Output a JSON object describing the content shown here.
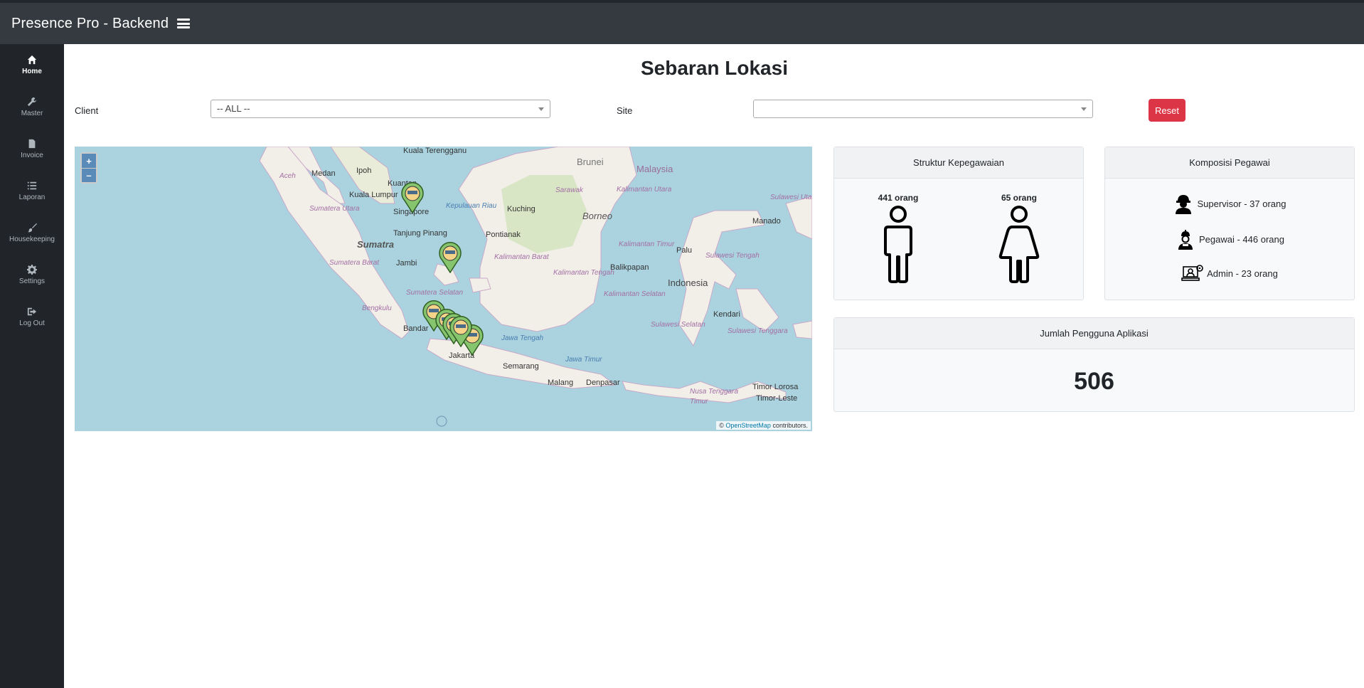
{
  "app": {
    "title": "Presence Pro - Backend"
  },
  "sidebar": {
    "items": [
      {
        "label": "Home",
        "icon": "home-icon"
      },
      {
        "label": "Master",
        "icon": "wrench-icon"
      },
      {
        "label": "Invoice",
        "icon": "file-icon"
      },
      {
        "label": "Laporan",
        "icon": "list-icon"
      },
      {
        "label": "Housekeeping",
        "icon": "brush-icon"
      },
      {
        "label": "Settings",
        "icon": "gear-icon"
      },
      {
        "label": "Log Out",
        "icon": "logout-icon"
      }
    ]
  },
  "page": {
    "title": "Sebaran Lokasi"
  },
  "filters": {
    "client_label": "Client",
    "client_value": "-- ALL --",
    "site_label": "Site",
    "site_value": "",
    "reset_label": "Reset"
  },
  "map": {
    "zoom_in": "+",
    "zoom_out": "–",
    "attribution_prefix": "©",
    "attribution_link": "OpenStreetMap",
    "attribution_suffix": "contributors.",
    "places": {
      "kuala_terengganu": "Kuala Terengganu",
      "brunei": "Brunei",
      "malaysia": "Malaysia",
      "medan": "Medan",
      "aceh": "Aceh",
      "ipoh": "Ipoh",
      "kuantan": "Kuantan",
      "kuala_lumpur": "Kuala Lumpur",
      "singapore": "Singapore",
      "sarawak": "Sarawak",
      "kalimantan_utara": "Kalimantan Utara",
      "sulawesi_utara": "Sulawesi Utara",
      "manado": "Manado",
      "sumatera_utara": "Sumatera Utara",
      "kepulauan_riau": "Kepulauan Riau",
      "kuching": "Kuching",
      "borneo": "Borneo",
      "tanjung_pinang": "Tanjung Pinang",
      "pontianak": "Pontianak",
      "sumatra": "Sumatra",
      "kalimantan_timur": "Kalimantan Timur",
      "jambi": "Jambi",
      "kalimantan_barat": "Kalimantan Barat",
      "palu": "Palu",
      "sulawesi_tengah": "Sulawesi Tengah",
      "sumatera_barat": "Sumatera Barat",
      "balikpapan": "Balikpapan",
      "indonesia": "Indonesia",
      "kalimantan_tengah": "Kalimantan Tengah",
      "kalimantan_selatan": "Kalimantan Selatan",
      "sumatera_selatan": "Sumatera Selatan",
      "bengkulu": "Bengkulu",
      "bandar": "Bandar",
      "kendari": "Kendari",
      "sulawesi_selatan": "Sulawesi Selatan",
      "sulawesi_tenggara": "Sulawesi Tenggara",
      "jawa_tengah": "Jawa Tengah",
      "jakarta": "Jakarta",
      "jawa_timur": "Jawa Timur",
      "semarang": "Semarang",
      "malang": "Malang",
      "denpasar": "Denpasar",
      "nusa_tenggara_timur": "Nusa Tenggara Timur",
      "timor_loro": "Timor Lorosa",
      "timor_leste": "Timor-Leste"
    }
  },
  "struktur": {
    "title": "Struktur Kepegawaian",
    "male_count": "441 orang",
    "female_count": "65 orang"
  },
  "komposisi": {
    "title": "Komposisi Pegawai",
    "supervisor": "Supervisor - 37 orang",
    "pegawai": "Pegawai - 446 orang",
    "admin": "Admin - 23 orang"
  },
  "pengguna": {
    "title": "Jumlah Pengguna Aplikasi",
    "value": "506"
  },
  "colors": {
    "topbar": "#343a40",
    "sidebar": "#212529",
    "reset": "#dc3545",
    "water": "#aad3df",
    "land": "#f2efe9",
    "forest": "#c8dfae",
    "marker": "#86c46e"
  }
}
